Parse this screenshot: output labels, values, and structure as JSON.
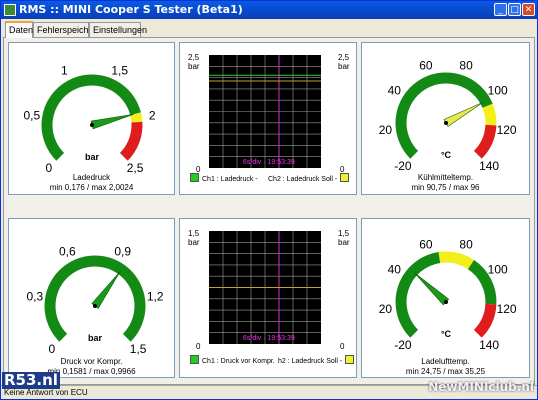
{
  "window": {
    "title": "RMS :: MINI Cooper S Tester (Beta1)",
    "buttons": {
      "minimize": "_",
      "maximize": "□",
      "close": "✕"
    }
  },
  "tabs": [
    {
      "label": "Daten",
      "active": true
    },
    {
      "label": "Fehlerspeicher",
      "active": false
    },
    {
      "label": "Einstellungen",
      "active": false
    }
  ],
  "colors": {
    "gauge_green": "#138a13",
    "gauge_yellow": "#f2ef1a",
    "gauge_red": "#e01d1d",
    "needle": "#1a9a1a",
    "needle_yellow": "#e7e84a",
    "scope_grid": "#9a9a9a",
    "scope_line_green": "#33d133",
    "scope_line_orange": "#c9a12a",
    "scope_marker": "#cc33cc",
    "scope_text": "#e838e8",
    "legend_ch1": "#22cc22",
    "legend_ch2": "#f0f030"
  },
  "gauges": [
    {
      "id": "ladedruck",
      "ticks": [
        "0",
        "0,5",
        "1",
        "1,5",
        "2",
        "2,5"
      ],
      "min": 0,
      "max": 2.5,
      "value": 1.95,
      "unit": "bar",
      "caption": "Ladedruck",
      "stats": "min 0,176 / max 2,0024",
      "bands": [
        {
          "from": 0,
          "to": 1.95,
          "color": "green"
        },
        {
          "from": 1.95,
          "to": 2.05,
          "color": "yellow"
        },
        {
          "from": 2.05,
          "to": 2.5,
          "color": "red"
        }
      ]
    },
    {
      "id": "kuehlmittel",
      "ticks": [
        "-20",
        "20",
        "40",
        "60",
        "80",
        "100",
        "120",
        "140"
      ],
      "min": -20,
      "max": 140,
      "value": 96,
      "unit": "°C",
      "caption": "Kühlmitteltemp.",
      "stats": "min 90,75 / max 96",
      "bands": [
        {
          "from": -20,
          "to": 100,
          "color": "green"
        },
        {
          "from": 100,
          "to": 115,
          "color": "yellow"
        },
        {
          "from": 115,
          "to": 140,
          "color": "red"
        }
      ]
    },
    {
      "id": "druck-vor-kompr",
      "ticks": [
        "0",
        "0,3",
        "0,6",
        "0,9",
        "1,2",
        "1,5"
      ],
      "min": 0,
      "max": 1.5,
      "value": 0.95,
      "unit": "bar",
      "caption": "Druck vor Kompr.",
      "stats": "min 0,1581 / max 0,9966",
      "bands": [
        {
          "from": 0,
          "to": 1.5,
          "color": "green"
        }
      ]
    },
    {
      "id": "ladeluft",
      "ticks": [
        "-20",
        "20",
        "40",
        "60",
        "80",
        "100",
        "120",
        "140"
      ],
      "min": -20,
      "max": 140,
      "value": 32,
      "unit": "°C",
      "caption": "Ladelufttemp.",
      "stats": "min 24,75 / max 35,25",
      "bands": [
        {
          "from": -20,
          "to": 55,
          "color": "green"
        },
        {
          "from": 55,
          "to": 80,
          "color": "yellow"
        },
        {
          "from": 80,
          "to": 115,
          "color": "green"
        },
        {
          "from": 115,
          "to": 140,
          "color": "red"
        }
      ]
    }
  ],
  "scopes": [
    {
      "id": "scope-1",
      "y_top": "2,5",
      "y_bottom": "0",
      "unit": "bar",
      "time_label": "6s/div · 19:53:39",
      "legend_left": "Ch1 : Ladedruck -",
      "legend_right": "Ch2 : Ladedruck Soll -",
      "ch1_level": 0.77,
      "ch2_level": 0.82
    },
    {
      "id": "scope-2",
      "y_top": "1,5",
      "y_bottom": "0",
      "unit": "bar",
      "time_label": "6s/div · 19:53:39",
      "legend_left": "Ch1 : Druck vor Kompr.",
      "legend_right": "h2 : Ladedruck Soll -",
      "ch1_level": 0.5,
      "ch2_level": 0.5
    }
  ],
  "status": {
    "text": "Keine Antwort von ECU"
  },
  "watermarks": {
    "left": "R53.nl",
    "right": "NewMINIclub.nl"
  }
}
